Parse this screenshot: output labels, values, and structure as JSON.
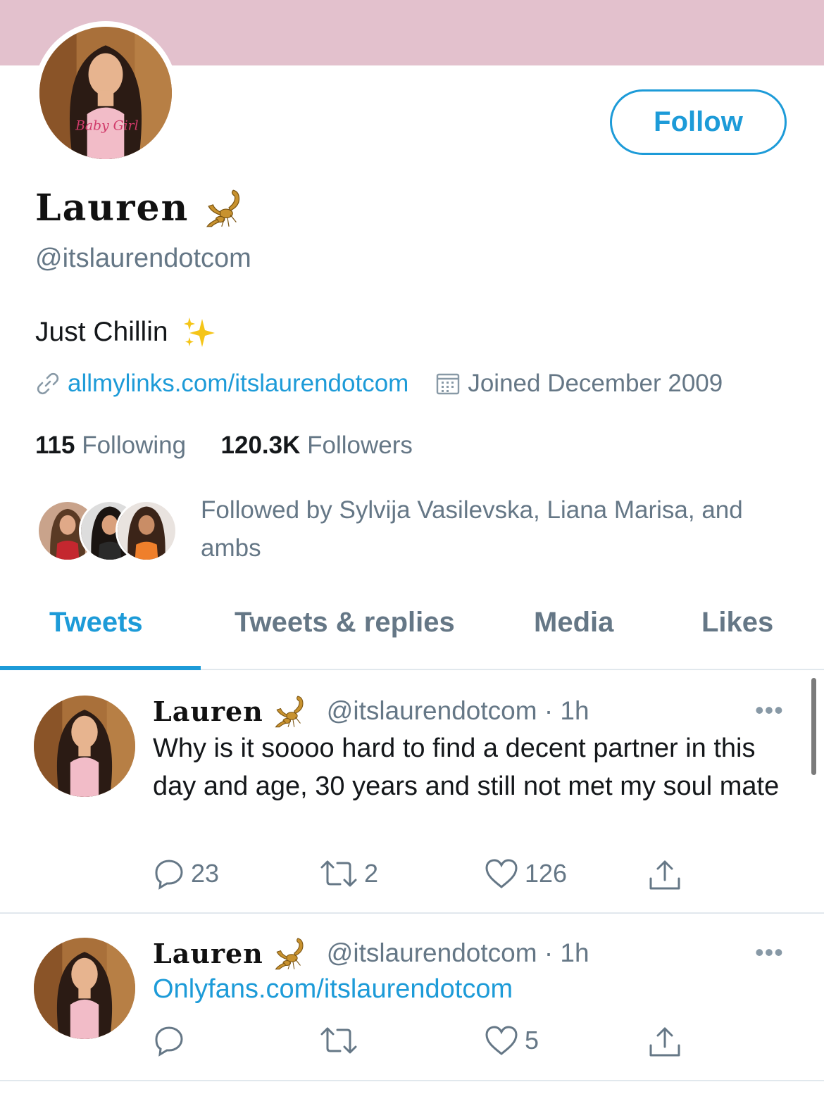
{
  "profile": {
    "display_name": "Lauren",
    "handle": "@itslaurendotcom",
    "bio": "Just Chillin",
    "website": "allmylinks.com/itslaurendotcom",
    "joined": "Joined December 2009",
    "following_count": "115",
    "following_label": "Following",
    "followers_count": "120.3K",
    "followers_label": "Followers",
    "followed_by": "Followed by Sylvija Vasilevska, Liana Marisa, and ambs",
    "follow_label": "Follow",
    "shirt_text": "Baby Girl"
  },
  "tabs": [
    {
      "label": "Tweets",
      "active": true
    },
    {
      "label": "Tweets & replies",
      "active": false
    },
    {
      "label": "Media",
      "active": false
    },
    {
      "label": "Likes",
      "active": false
    }
  ],
  "tweets": [
    {
      "name": "Lauren",
      "handle_time": "@itslaurendotcom · 1h",
      "text": "Why is it soooo hard to find a decent partner in this day and age, 30 years and still not met my soul mate",
      "replies": "23",
      "retweets": "2",
      "likes": "126",
      "more": "•••"
    },
    {
      "name": "Lauren",
      "handle_time": "@itslaurendotcom · 1h",
      "link": "Onlyfans.com/itslaurendotcom",
      "replies": "",
      "retweets": "",
      "likes": "5",
      "more": "•••"
    }
  ],
  "colors": {
    "accent": "#1d9bd8",
    "banner": "#e3c1cd",
    "secondary_text": "#657786"
  }
}
